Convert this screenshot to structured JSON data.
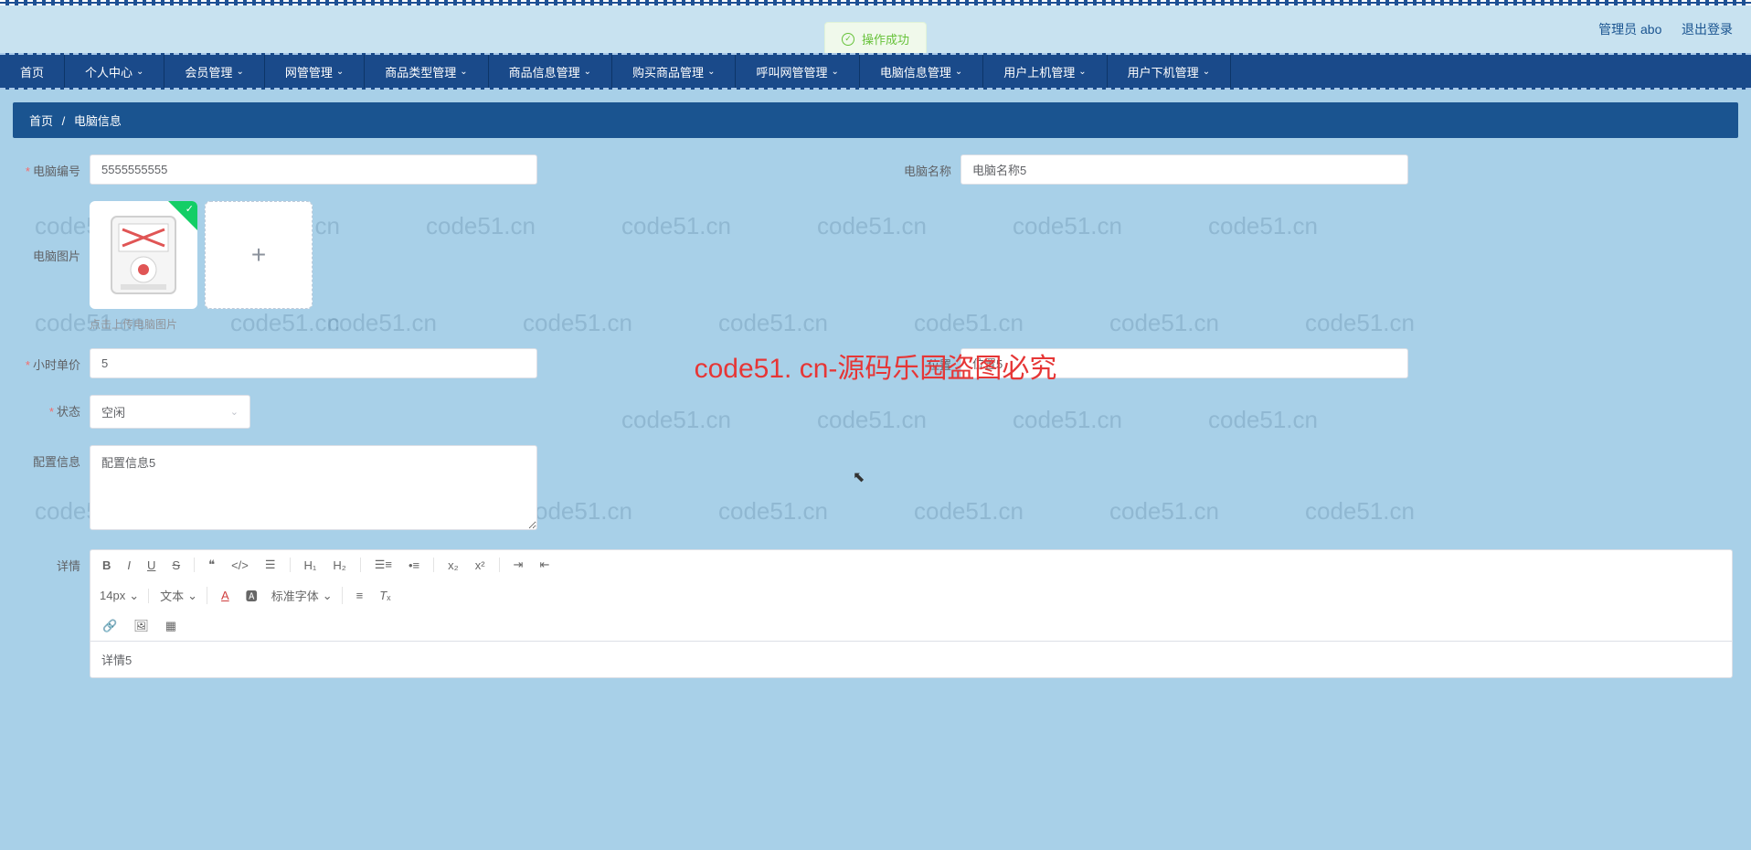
{
  "header": {
    "admin_label": "管理员 abo",
    "logout_label": "退出登录"
  },
  "toast": {
    "text": "操作成功"
  },
  "nav": [
    {
      "label": "首页",
      "drop": false
    },
    {
      "label": "个人中心",
      "drop": true
    },
    {
      "label": "会员管理",
      "drop": true
    },
    {
      "label": "网管管理",
      "drop": true
    },
    {
      "label": "商品类型管理",
      "drop": true
    },
    {
      "label": "商品信息管理",
      "drop": true
    },
    {
      "label": "购买商品管理",
      "drop": true
    },
    {
      "label": "呼叫网管管理",
      "drop": true
    },
    {
      "label": "电脑信息管理",
      "drop": true
    },
    {
      "label": "用户上机管理",
      "drop": true
    },
    {
      "label": "用户下机管理",
      "drop": true
    }
  ],
  "breadcrumb": {
    "home": "首页",
    "current": "电脑信息"
  },
  "form": {
    "computer_no": {
      "label": "电脑编号",
      "value": "5555555555"
    },
    "computer_name": {
      "label": "电脑名称",
      "value": "电脑名称5"
    },
    "computer_image": {
      "label": "电脑图片",
      "hint": "点击上传电脑图片"
    },
    "hour_price": {
      "label": "小时单价",
      "value": "5"
    },
    "position": {
      "label": "位置",
      "value": "位置5"
    },
    "status": {
      "label": "状态",
      "value": "空闲"
    },
    "config_info": {
      "label": "配置信息",
      "value": "配置信息5"
    },
    "detail": {
      "label": "详情",
      "value": "详情5"
    }
  },
  "editor": {
    "font_size": "14px",
    "font_family": "文本",
    "format": "标准字体"
  },
  "watermark": {
    "text": "code51.cn",
    "center": "code51. cn-源码乐园盗图必究"
  }
}
